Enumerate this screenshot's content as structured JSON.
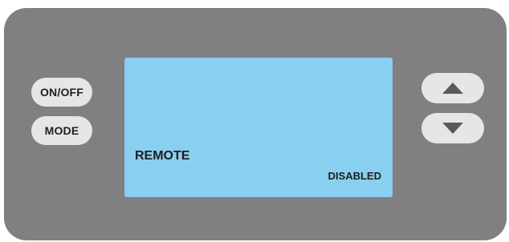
{
  "controls": {
    "power_label": "ON/OFF",
    "mode_label": "MODE"
  },
  "display": {
    "line1": "REMOTE",
    "status": "DISABLED"
  },
  "icons": {
    "up": "triangle-up-icon",
    "down": "triangle-down-icon"
  },
  "colors": {
    "panel": "#808083",
    "screen": "#89cff0",
    "button": "#e6e6e6",
    "text": "#1e1e1e"
  }
}
